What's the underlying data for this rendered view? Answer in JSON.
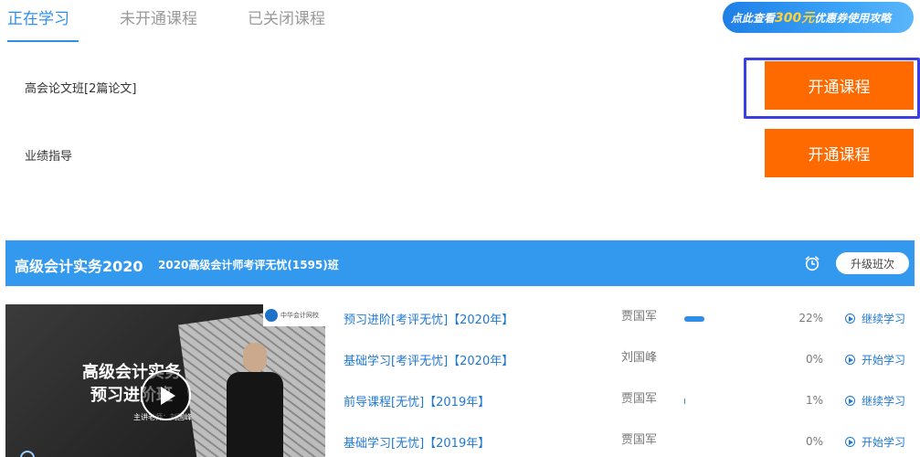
{
  "tabs": [
    {
      "label": "正在学习",
      "active": true
    },
    {
      "label": "未开通课程",
      "active": false
    },
    {
      "label": "已关闭课程",
      "active": false
    }
  ],
  "coupon": {
    "prefix": "点此查看",
    "amount": "300元",
    "suffix": "优惠券使用攻略"
  },
  "unopened": [
    {
      "name": "高会论文班[2篇论文]",
      "button": "开通课程"
    },
    {
      "name": "业绩指导",
      "button": "开通课程"
    }
  ],
  "course": {
    "title": "高级会计实务2020",
    "class_name": "2020高级会计师考评无忧(1595)班",
    "upgrade_label": "升级班次",
    "thumbnail": {
      "title_line1": "高级会计实务",
      "title_line2": "预习进阶班",
      "presenter": "主讲老师：刘国峰",
      "logo_text": "中华会计网校"
    },
    "lessons": [
      {
        "name": "预习进阶[考评无忧]【2020年】",
        "teacher": "贾国军",
        "progress": 22,
        "percent": "22%",
        "action": "继续学习"
      },
      {
        "name": "基础学习[考评无忧]【2020年】",
        "teacher": "刘国峰",
        "progress": 0,
        "percent": "0%",
        "action": "开始学习"
      },
      {
        "name": "前导课程[无忧]【2019年】",
        "teacher": "贾国军",
        "progress": 1,
        "percent": "1%",
        "action": "继续学习"
      },
      {
        "name": "基础学习[无忧]【2019年】",
        "teacher": "贾国军",
        "progress": 0,
        "percent": "0%",
        "action": "开始学习"
      }
    ]
  },
  "colors": {
    "accent": "#2f8fe8",
    "button": "#ff6a00",
    "bar": "#3399ee",
    "focus": "#3a3fe0"
  },
  "icons": {
    "alarm": "alarm-clock-icon",
    "play": "play-icon",
    "play_circle": "play-circle-icon"
  }
}
